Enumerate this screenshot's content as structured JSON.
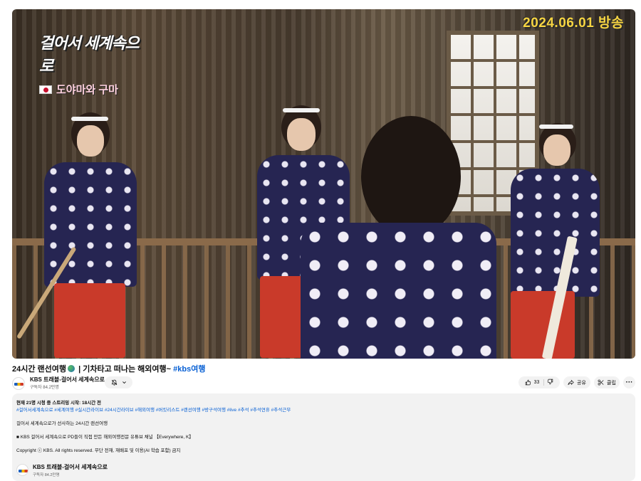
{
  "video": {
    "overlay": {
      "show_title": "걸어서 세계속으로",
      "episode_subtitle": "도야마와 구마",
      "broadcast_date": "2024.06.01 방송"
    }
  },
  "title": {
    "text_before": "24시간 랜선여행",
    "text_after": " | 기차타고 떠나는 해외여행~ ",
    "hashtag": "#kbs여행"
  },
  "channel": {
    "name": "KBS 트래블-걸어서 세계속으로",
    "subscribers": "구독자 84.2만명",
    "brand_colors": [
      "#1c5fbf",
      "#f2b705",
      "#d03b2a"
    ]
  },
  "notify": {
    "bell_icon": "bell-off-icon",
    "chevron_icon": "chevron-down-icon"
  },
  "actions": {
    "like_count": "33",
    "like_icon": "thumbs-up-icon",
    "dislike_icon": "thumbs-down-icon",
    "share_label": "공유",
    "clip_label": "클립",
    "more_label": "···"
  },
  "description": {
    "meta": "현재 21명 시청 중  스트리밍 시작: 18시간 전",
    "hashtags": "#걸어서세계속으로 #세계여행 #실시간라이브 #24시간라이브 #해외여행 #버킷리스트 #랜선여행 #방구석여행 #live #추석 #추석연휴 #추석근무",
    "line1": "걸어서 세계속으로가 선사하는 24시간 랜선여행",
    "line2": "■ KBS 걸어서 세계속으로 PD들이 직접 만든 해외여행전문 유튜브 채널 【Everywhere, K】",
    "line3": "Copyright ⓒ KBS. All rights reserved. 무단 전재, 재배포 및 이용(AI 학습 포함) 금지",
    "channel_name": "KBS 트래블-걸어서 세계속으로",
    "channel_subscribers": "구독자 84.2만명"
  },
  "colors": {
    "link": "#065fd4",
    "date_overlay": "#f6d442",
    "kimono": "#262552",
    "skirt": "#c93a2a"
  }
}
